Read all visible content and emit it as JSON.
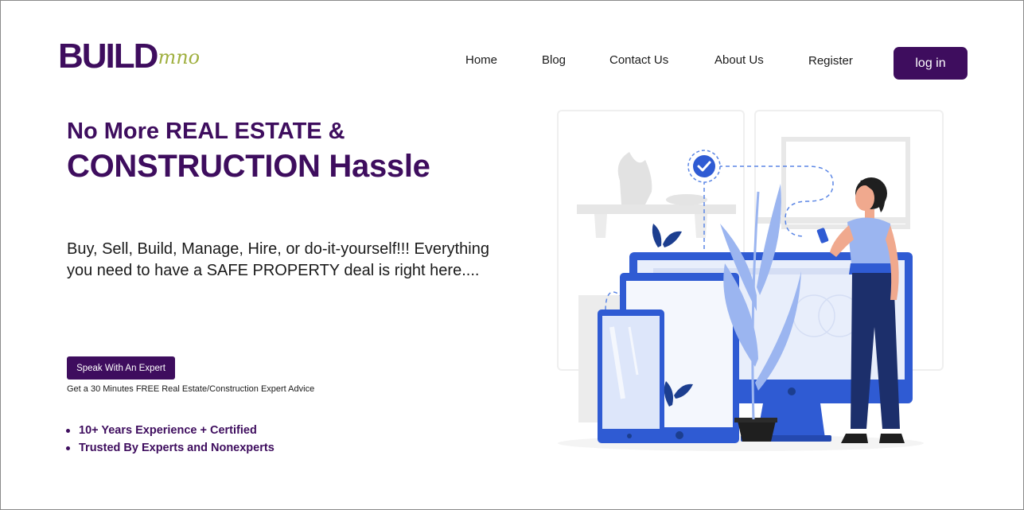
{
  "logo": {
    "main": "BUILD",
    "sub": "mno"
  },
  "nav": {
    "home": "Home",
    "blog": "Blog",
    "contact": "Contact Us",
    "about": "About Us",
    "register": "Register",
    "login": "log in"
  },
  "hero": {
    "line1": "No More REAL ESTATE &",
    "line2": "CONSTRUCTION Hassle",
    "lead": "Buy, Sell, Build, Manage, Hire, or do-it-yourself!!! Everything you need to have a SAFE PROPERTY deal is right here....",
    "cta": "Speak With An Expert",
    "cta_note": "Get a 30 Minutes FREE Real Estate/Construction Expert Advice",
    "bullets": [
      "10+ Years Experience + Certified",
      "Trusted By Experts and Nonexperts"
    ]
  },
  "colors": {
    "brand": "#3e0d5e",
    "accent": "#a0b040",
    "illustration_blue": "#2f5bd3"
  },
  "icons": {
    "illustration": "person-with-devices-illustration",
    "check": "check-circle-icon"
  }
}
